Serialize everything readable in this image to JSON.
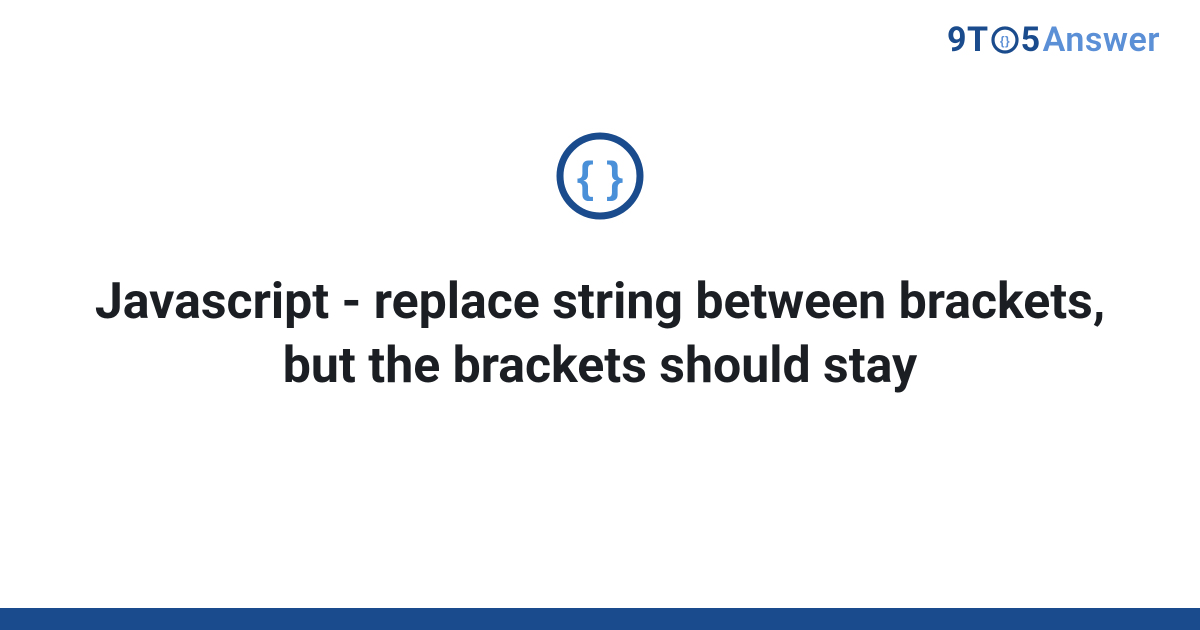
{
  "brand": {
    "nine": "9",
    "t": "T",
    "five": "5",
    "answer": "Answer"
  },
  "icon": {
    "name": "curly-braces-icon"
  },
  "title": "Javascript - replace string between brackets, but the brackets should stay",
  "colors": {
    "accent_dark": "#1a4b8c",
    "accent_light": "#5b8fd6",
    "brace_blue": "#4a90d9"
  }
}
